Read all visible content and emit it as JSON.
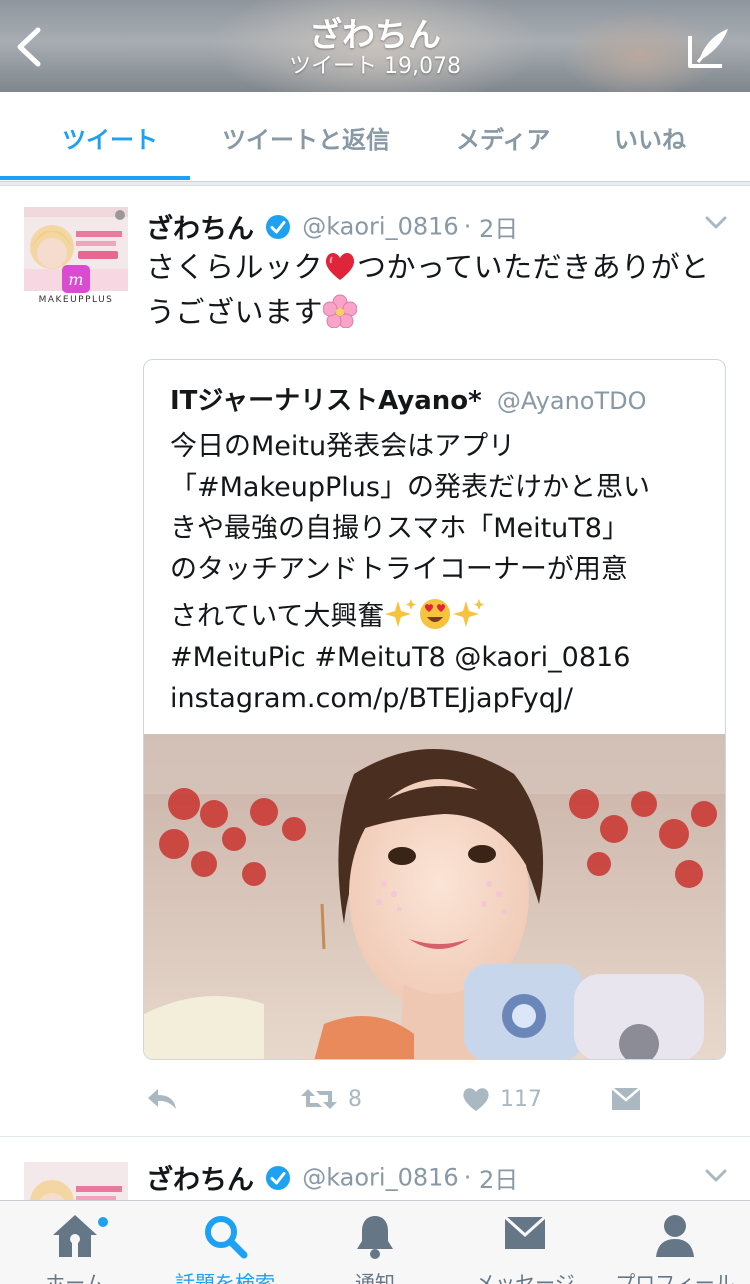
{
  "header": {
    "title": "ざわちん",
    "subtitle": "ツイート 19,078"
  },
  "tabs": [
    {
      "label": "ツイート",
      "active": true
    },
    {
      "label": "ツイートと返信",
      "active": false
    },
    {
      "label": "メディア",
      "active": false
    },
    {
      "label": "いいね",
      "active": false
    }
  ],
  "tweet": {
    "author_name": "ざわちん",
    "author_handle": "@kaori_0816",
    "time": "2日",
    "avatar_brand": "MAKEUPPLUS",
    "text_line1": "さくらルック",
    "text_line1b": "つかっていただきありがと",
    "text_line2": "うございます",
    "emoji_1": "red-heart",
    "emoji_2": "cherry-blossom",
    "quote": {
      "author_name": "ITジャーナリストAyano*",
      "author_handle": "@AyanoTDO",
      "lines": [
        "今日のMeitu発表会はアプリ",
        "「#MakeupPlus」の発表だけかと思い",
        "きや最強の自撮りスマホ「MeituT8」",
        "のタッチアンドトライコーナーが用意",
        "されていて大興奮",
        "#MeituPic #MeituT8 @kaori_0816",
        "instagram.com/p/BTEJjapFyqJ/"
      ]
    },
    "actions": {
      "reply_count": "",
      "retweet_count": "8",
      "like_count": "117"
    }
  },
  "tweet2": {
    "author_name": "ざわちん",
    "author_handle": "@kaori_0816",
    "time": "2日"
  },
  "bottom_nav": [
    {
      "label": "ホーム",
      "icon": "home-icon",
      "active": false,
      "badge": true
    },
    {
      "label": "話題を検索",
      "icon": "search-icon",
      "active": true
    },
    {
      "label": "通知",
      "icon": "bell-icon",
      "active": false
    },
    {
      "label": "メッセージ",
      "icon": "mail-icon",
      "active": false
    },
    {
      "label": "プロフィール",
      "icon": "profile-icon",
      "active": false
    }
  ],
  "colors": {
    "accent": "#1da1f2",
    "muted": "#8899a6",
    "text": "#14171a"
  }
}
